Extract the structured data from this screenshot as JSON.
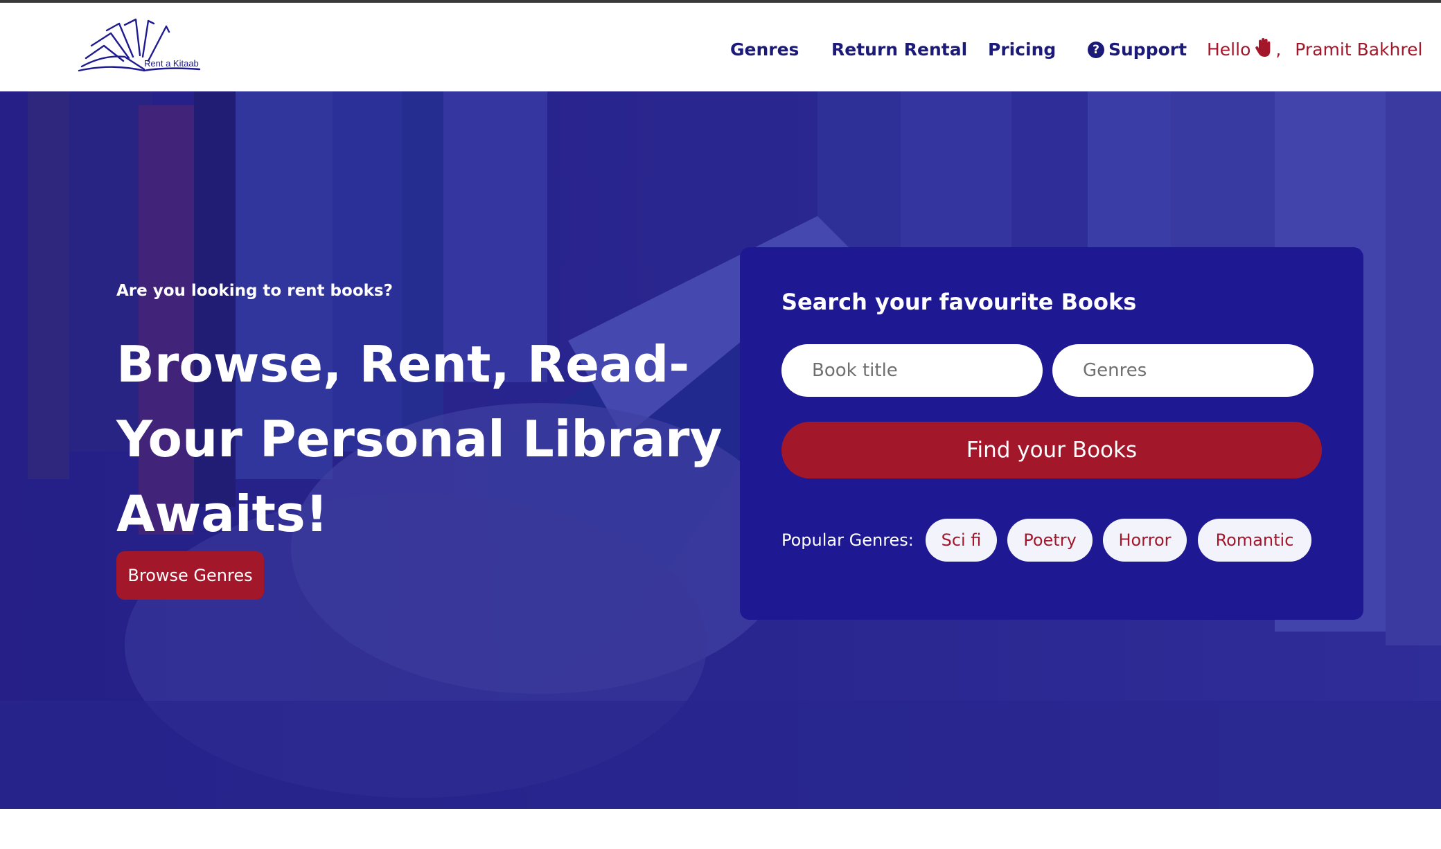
{
  "header": {
    "logo_text": "Rent a Kitaab",
    "nav": [
      {
        "label": "Genres"
      },
      {
        "label": "Return Rental"
      },
      {
        "label": "Pricing"
      },
      {
        "label": "Support",
        "icon": "question-circle-icon"
      }
    ],
    "greeting": {
      "hello": "Hello",
      "separator": ",",
      "user_name": "Pramit Bakhrel",
      "icon": "waving-hand-icon"
    }
  },
  "hero": {
    "subtitle": "Are you looking to rent books?",
    "headline_lines": [
      "Browse, Rent, Read-",
      "Your Personal Library",
      "Awaits!"
    ],
    "browse_button": "Browse Genres"
  },
  "search": {
    "title": "Search your favourite Books",
    "book_title_placeholder": "Book title",
    "genres_placeholder": "Genres",
    "find_button": "Find your Books",
    "popular_label": "Popular Genres:",
    "popular_genres": [
      "Sci fi",
      "Poetry",
      "Horror",
      "Romantic"
    ]
  },
  "colors": {
    "brand_navy": "#1b1a78",
    "panel_blue": "#1e1892",
    "accent_red": "#a3172b",
    "chip_bg": "#f3f4fb"
  }
}
